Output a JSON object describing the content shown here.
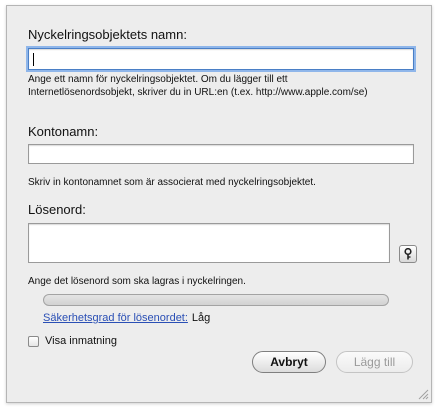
{
  "item_name": {
    "label": "Nyckelringsobjektets namn:",
    "value": "",
    "help_line1": "Ange ett namn för nyckelringsobjektet. Om du lägger till ett",
    "help_line2": "Internetlösenordsobjekt, skriver du in URL:en (t.ex. http://www.apple.com/se)"
  },
  "account": {
    "label": "Kontonamn:",
    "value": "",
    "help": "Skriv in kontonamnet som är associerat med nyckelringsobjektet."
  },
  "password": {
    "label": "Lösenord:",
    "value": "",
    "help": "Ange det lösenord som ska lagras i nyckelringen.",
    "assistant_icon": "key-icon"
  },
  "strength": {
    "fill": 0,
    "link_label": "Säkerhetsgrad för lösenordet:",
    "quality": "Låg"
  },
  "show_typing": {
    "label": "Visa inmatning",
    "checked": false
  },
  "buttons": {
    "cancel": "Avbryt",
    "add": "Lägg till"
  },
  "colors": {
    "focus_ring": "#8fb6ea",
    "link": "#2a4fb5",
    "dialog_bg": "#ededed"
  }
}
